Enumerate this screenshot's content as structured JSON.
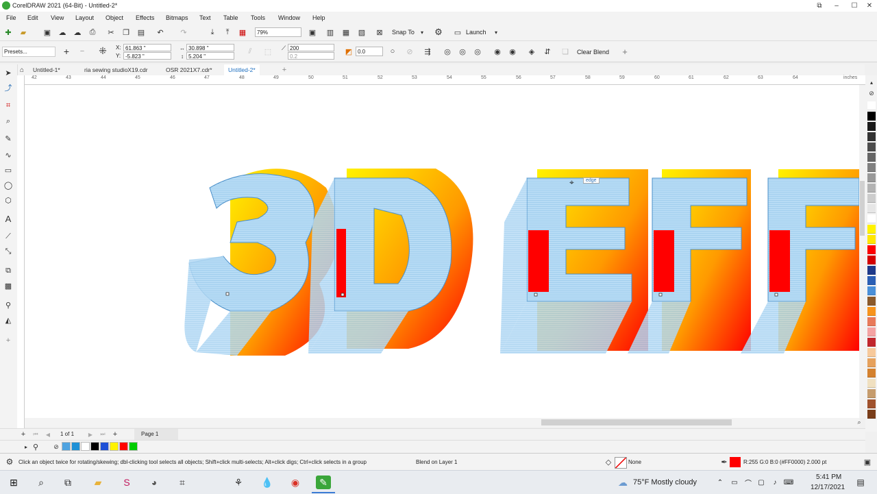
{
  "window": {
    "title": "CorelDRAW 2021 (64-Bit) - Untitled-2*",
    "buttons": [
      "minimize",
      "maximize",
      "close"
    ]
  },
  "menu": [
    "File",
    "Edit",
    "View",
    "Layout",
    "Object",
    "Effects",
    "Bitmaps",
    "Text",
    "Table",
    "Tools",
    "Window",
    "Help"
  ],
  "standard_toolbar": {
    "zoom_value": "79%",
    "snap_label": "Snap To",
    "launch_label": "Launch"
  },
  "property_bar": {
    "presets_label": "Presets...",
    "x_value": "61.863 \"",
    "y_value": "-5.823 \"",
    "w_value": "30.898 \"",
    "h_value": "5.204 \"",
    "x_label": "X:",
    "y_label": "Y:",
    "steps_value": "200",
    "spacing_value": "0.2",
    "angle_value": "0.0",
    "clear_blend_label": "Clear Blend"
  },
  "doc_tabs": [
    {
      "label": "Untitled-1*",
      "active": false
    },
    {
      "label": "ria sewing studioX19.cdr",
      "active": false
    },
    {
      "label": "OSR 2021X7.cdr*",
      "active": false
    },
    {
      "label": "Untitled-2*",
      "active": true
    }
  ],
  "ruler": {
    "h_ticks": [
      "42",
      "43",
      "44",
      "45",
      "46",
      "47",
      "48",
      "49",
      "50",
      "51",
      "52",
      "53",
      "54",
      "55",
      "56",
      "57",
      "58",
      "59",
      "60",
      "61",
      "62",
      "63",
      "64"
    ],
    "unit": "inches"
  },
  "canvas": {
    "text": "3D EFF",
    "tooltip": "edge"
  },
  "page_nav": {
    "page_count": "1 of 1",
    "page_tab": "Page 1"
  },
  "status": {
    "hint": "Click an object twice for rotating/skewing; dbl-clicking tool selects all objects; Shift+click multi-selects; Alt+click digs; Ctrl+click selects in a group",
    "layer_info": "Blend on Layer 1",
    "fill_label": "None",
    "outline_info": "R:255 G:0 B:0 (#FF0000)  2.000 pt"
  },
  "palette_colors": [
    "#ffffff",
    "#000000",
    "#1a1a1a",
    "#333333",
    "#4d4d4d",
    "#666666",
    "#808080",
    "#999999",
    "#b3b3b3",
    "#cccccc",
    "#e6e6e6",
    "#ffffff",
    "#fff200",
    "#ffe600",
    "#ff0000",
    "#d40000",
    "#1e3a8a",
    "#2b5fb5",
    "#4a90d9",
    "#8b5a2b",
    "#f7941d",
    "#e87a5a",
    "#f4a3a3",
    "#c1272d",
    "#f7c99b",
    "#e6a15c",
    "#d4812e",
    "#f0e0c0",
    "#c69c6d",
    "#a0522d",
    "#7a3e1a"
  ],
  "doc_palette": [
    "#4fa3e0",
    "#1e90d6",
    "#ffffff",
    "#000000",
    "#1e4fd6",
    "#fff200",
    "#ff0000",
    "#00cc00"
  ],
  "taskbar": {
    "weather": "75°F  Mostly cloudy",
    "time": "5:41 PM",
    "date": "12/17/2021"
  }
}
